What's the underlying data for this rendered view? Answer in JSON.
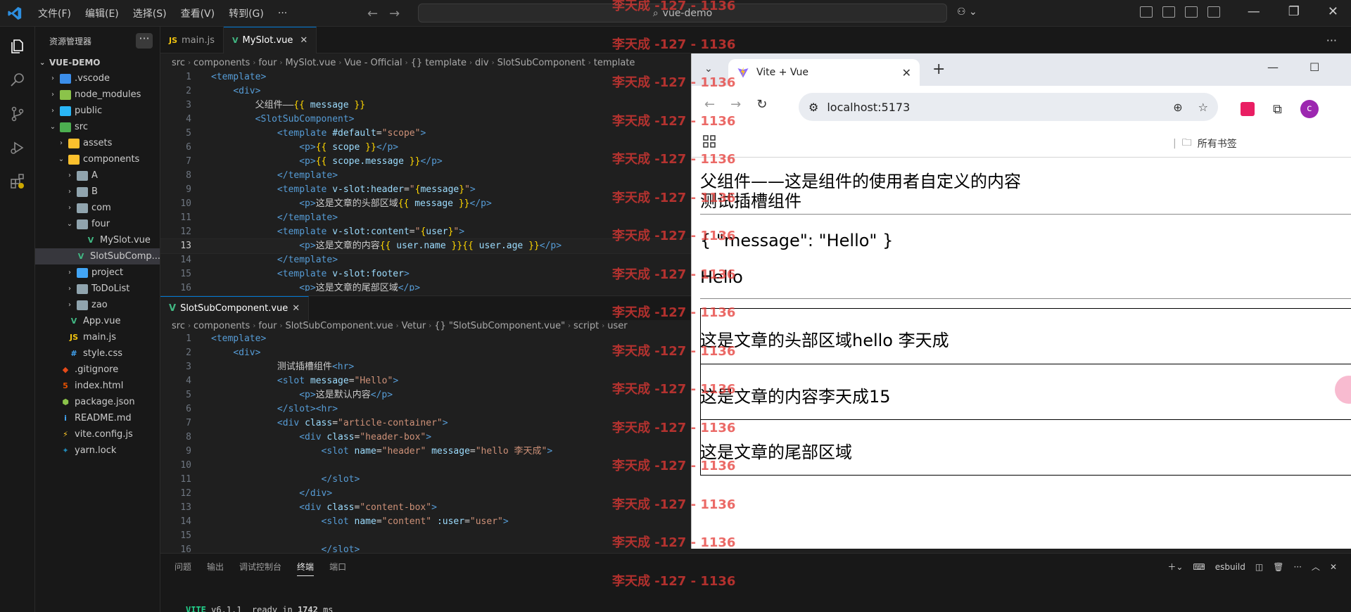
{
  "menu": [
    "文件(F)",
    "编辑(E)",
    "选择(S)",
    "查看(V)",
    "转到(G)",
    "···"
  ],
  "command_center": "vue-demo",
  "sidebar": {
    "title": "资源管理器",
    "root": "VUE-DEMO",
    "items": [
      {
        "label": ".vscode",
        "depth": 1,
        "folder": true,
        "open": false,
        "color": "#3b8eea"
      },
      {
        "label": "node_modules",
        "depth": 1,
        "folder": true,
        "open": false,
        "color": "#8bc34a"
      },
      {
        "label": "public",
        "depth": 1,
        "folder": true,
        "open": false,
        "color": "#29b6f6"
      },
      {
        "label": "src",
        "depth": 1,
        "folder": true,
        "open": true,
        "color": "#4caf50"
      },
      {
        "label": "assets",
        "depth": 2,
        "folder": true,
        "open": false,
        "color": "#fbc02d"
      },
      {
        "label": "components",
        "depth": 2,
        "folder": true,
        "open": true,
        "color": "#fbc02d"
      },
      {
        "label": "A",
        "depth": 3,
        "folder": true,
        "open": false,
        "color": "#90a4ae"
      },
      {
        "label": "B",
        "depth": 3,
        "folder": true,
        "open": false,
        "color": "#90a4ae"
      },
      {
        "label": "com",
        "depth": 3,
        "folder": true,
        "open": false,
        "color": "#90a4ae"
      },
      {
        "label": "four",
        "depth": 3,
        "folder": true,
        "open": true,
        "color": "#90a4ae"
      },
      {
        "label": "MySlot.vue",
        "depth": 4,
        "folder": false,
        "icon": "V",
        "color": "#41b883"
      },
      {
        "label": "SlotSubComp...",
        "depth": 4,
        "folder": false,
        "icon": "V",
        "color": "#41b883",
        "selected": true
      },
      {
        "label": "project",
        "depth": 3,
        "folder": true,
        "open": false,
        "color": "#42a5f5"
      },
      {
        "label": "ToDoList",
        "depth": 3,
        "folder": true,
        "open": false,
        "color": "#90a4ae"
      },
      {
        "label": "zao",
        "depth": 3,
        "folder": true,
        "open": false,
        "color": "#90a4ae"
      },
      {
        "label": "App.vue",
        "depth": 2,
        "folder": false,
        "icon": "V",
        "color": "#41b883"
      },
      {
        "label": "main.js",
        "depth": 2,
        "folder": false,
        "icon": "JS",
        "color": "#f1c40f"
      },
      {
        "label": "style.css",
        "depth": 2,
        "folder": false,
        "icon": "#",
        "color": "#42a5f5"
      },
      {
        "label": ".gitignore",
        "depth": 1,
        "folder": false,
        "icon": "◆",
        "color": "#e64a19"
      },
      {
        "label": "index.html",
        "depth": 1,
        "folder": false,
        "icon": "5",
        "color": "#e65100"
      },
      {
        "label": "package.json",
        "depth": 1,
        "folder": false,
        "icon": "⬢",
        "color": "#8bc34a"
      },
      {
        "label": "README.md",
        "depth": 1,
        "folder": false,
        "icon": "i",
        "color": "#42a5f5"
      },
      {
        "label": "vite.config.js",
        "depth": 1,
        "folder": false,
        "icon": "⚡",
        "color": "#ffca28"
      },
      {
        "label": "yarn.lock",
        "depth": 1,
        "folder": false,
        "icon": "✦",
        "color": "#2188b6"
      }
    ]
  },
  "tabs": [
    {
      "label": "main.js",
      "icon": "JS",
      "color": "#f1c40f",
      "active": false
    },
    {
      "label": "MySlot.vue",
      "icon": "V",
      "color": "#41b883",
      "active": true
    }
  ],
  "editor_top": {
    "breadcrumb": [
      "src",
      "components",
      "four",
      "MySlot.vue",
      "Vue - Official",
      "{} template",
      "div",
      "SlotSubComponent",
      "template"
    ],
    "current_line": 13
  },
  "editor_bottom": {
    "tab": "SlotSubComponent.vue",
    "breadcrumb": [
      "src",
      "components",
      "four",
      "SlotSubComponent.vue",
      "Vetur",
      "{} \"SlotSubComponent.vue\"",
      "script",
      "user"
    ]
  },
  "panel": {
    "tabs": [
      "问题",
      "输出",
      "调试控制台",
      "终端",
      "端口"
    ],
    "active": "终端",
    "terminal_name": "esbuild",
    "terminal_line": [
      "VITE",
      " v6.1.1  ready in ",
      "1742",
      " ms"
    ]
  },
  "browser": {
    "tab_title": "Vite + Vue",
    "url": "localhost:5173",
    "avatar": "c",
    "bookmarks_label": "所有书签",
    "content": {
      "parent_title": "父组件——这是组件的使用者自定义的内容",
      "test_title": "测试插槽组件",
      "scope_json": "{ \"message\": \"Hello\" }",
      "hello": "Hello",
      "header_text": "这是文章的头部区域hello 李天成",
      "content_text": "这是文章的内容李天成15",
      "footer_text": "这是文章的尾部区域"
    }
  },
  "watermark": "李天成 -127 - 1136"
}
